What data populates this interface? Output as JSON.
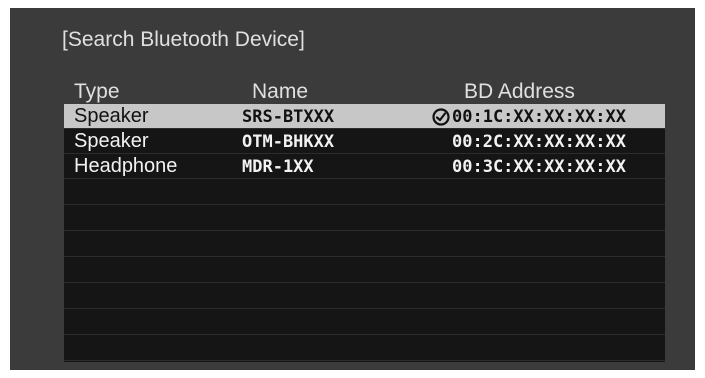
{
  "dialog": {
    "title": "[Search Bluetooth Device]",
    "columns": {
      "type": "Type",
      "name": "Name",
      "address": "BD Address"
    },
    "devices": [
      {
        "type": "Speaker",
        "name": "SRS-BTXXX",
        "address": "00:1C:XX:XX:XX:XX",
        "selected": true,
        "connected_icon": "connected-check-icon"
      },
      {
        "type": "Speaker",
        "name": "OTM-BHKXX",
        "address": "00:2C:XX:XX:XX:XX",
        "selected": false
      },
      {
        "type": "Headphone",
        "name": "MDR-1XX",
        "address": "00:3C:XX:XX:XX:XX",
        "selected": false
      }
    ]
  },
  "colors": {
    "panel": "#3b3b3b",
    "table": "#151515",
    "selected_row": "#c7c7c7"
  }
}
